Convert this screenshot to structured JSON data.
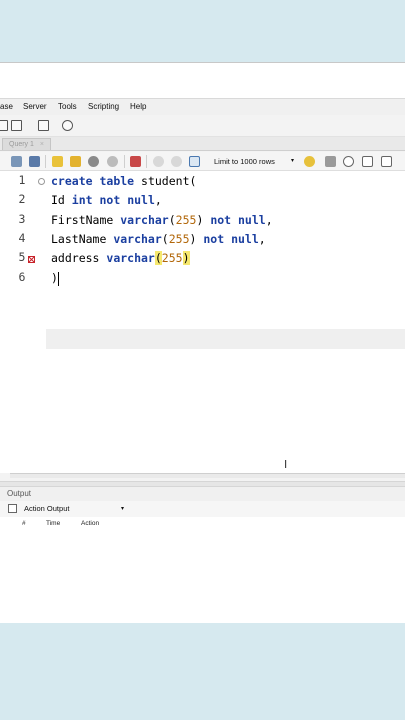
{
  "menu": [
    "ase",
    "Server",
    "Tools",
    "Scripting",
    "Help"
  ],
  "tab": {
    "label": "Query 1",
    "close": "×"
  },
  "toolbar": {
    "limit_label": "Limit to 1000 rows",
    "caret": "▾"
  },
  "editor": {
    "line_numbers": [
      "1",
      "2",
      "3",
      "4",
      "5",
      "6"
    ],
    "lines": {
      "l1": {
        "kw1": "create",
        "kw2": "table",
        "rest": " student("
      },
      "l2": {
        "a": "Id ",
        "kw1": "int",
        "kw2": "not null",
        "b": ","
      },
      "l3": {
        "a": "FirstName ",
        "kw1": "varchar",
        "paren_open": "(",
        "num": "255",
        "paren_close": ")",
        "kw2": "not null",
        "b": ","
      },
      "l4": {
        "a": "LastName ",
        "kw1": "varchar",
        "paren_open": "(",
        "num": "255",
        "paren_close": ")",
        "kw2": "not null",
        "b": ","
      },
      "l5": {
        "a": "address ",
        "kw1": "varchar",
        "paren_open": "(",
        "num": "255",
        "paren_close": ")"
      },
      "l6": {
        "a": ")"
      }
    }
  },
  "output": {
    "title": "Output",
    "selector": "Action Output",
    "columns": [
      "#",
      "Time",
      "Action"
    ]
  },
  "colors": {
    "keyword": "#1b3fa0",
    "number": "#b2670a",
    "bracket_highlight": "#f6e86e",
    "error_marker": "#c8232a"
  }
}
